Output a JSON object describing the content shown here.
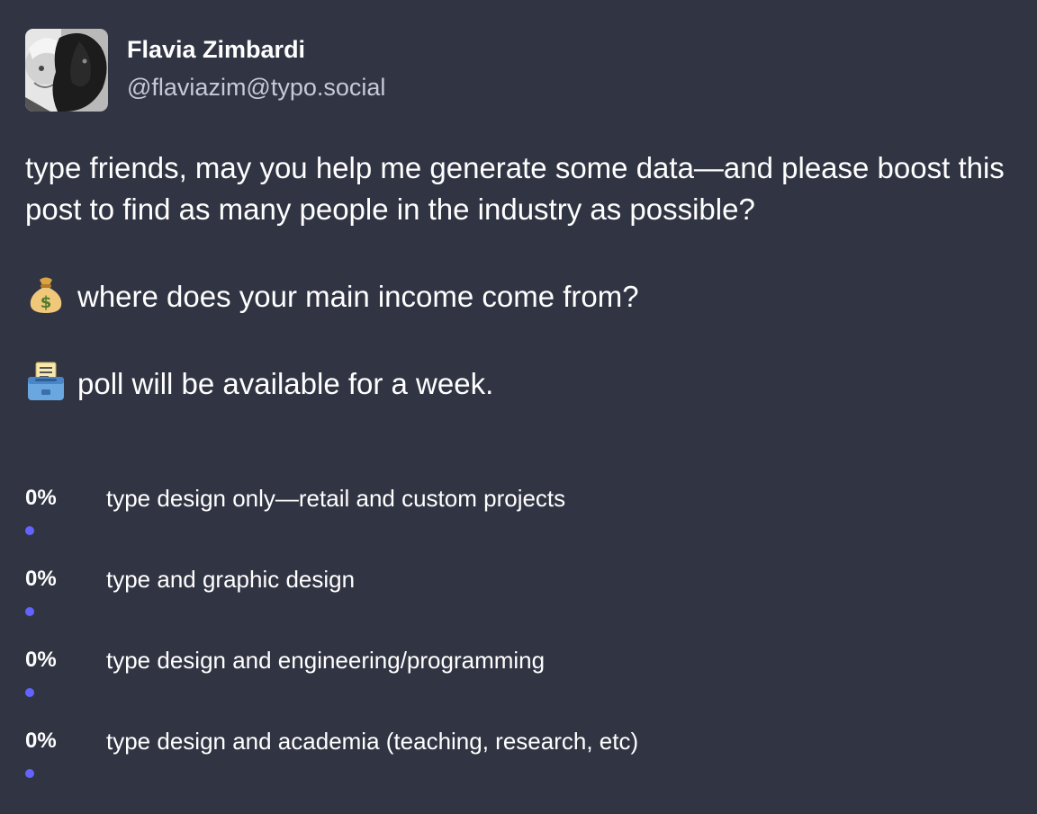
{
  "author": {
    "display_name": "Flavia Zimbardi",
    "handle": "@flaviazim@typo.social"
  },
  "post": {
    "intro": "type friends, may you help me generate some data—and please boost this post to find as many people in the industry as possible?",
    "question": "where does your main income come from?",
    "question_icon": "money-bag-icon",
    "note": "poll will be available for a week.",
    "note_icon": "ballot-box-icon"
  },
  "poll": {
    "bar_color": "#6364ff",
    "options": [
      {
        "percent_label": "0%",
        "percent": 0,
        "label": "type design only—retail and custom projects"
      },
      {
        "percent_label": "0%",
        "percent": 0,
        "label": "type and graphic design"
      },
      {
        "percent_label": "0%",
        "percent": 0,
        "label": "type design and engineering/programming"
      },
      {
        "percent_label": "0%",
        "percent": 0,
        "label": "type design and academia (teaching, research, etc)"
      }
    ]
  },
  "colors": {
    "background": "#313543",
    "text": "#ffffff",
    "secondary_text": "#c6c9d6",
    "accent": "#6364ff"
  }
}
